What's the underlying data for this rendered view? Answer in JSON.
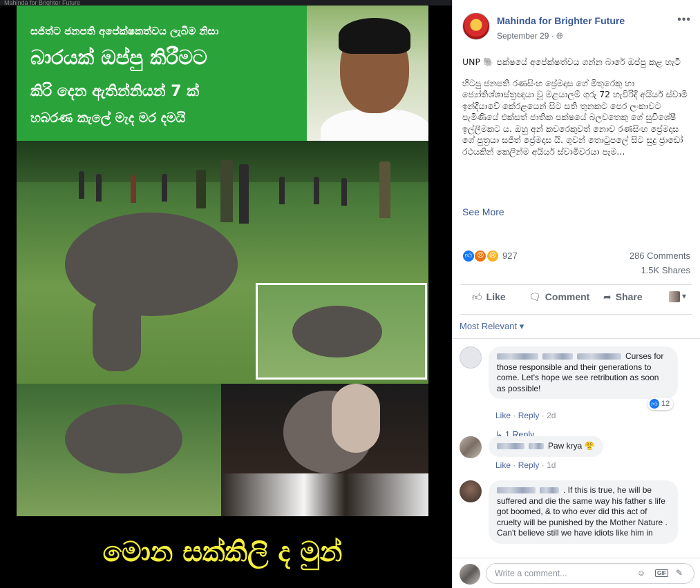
{
  "window": {
    "top_strip_text": "Mahinda for Brighter Future"
  },
  "photo": {
    "banner_lines": [
      "සජිත්ට ජනපති අපේක්ෂකත්වය ලැබීම නිසා",
      "බාරයක් ඔප්පු කිරීමට",
      "කිරි දෙන ඇතින්නියන් 7 ක්",
      "හබරණ කැලේ මැද මර දමයි"
    ],
    "caption": "මොන සක්කිලි ද මුන්"
  },
  "post": {
    "page_name": "Mahinda for Brighter Future",
    "date": "September 29",
    "audience_icon": "globe-icon",
    "more_icon": "•••",
    "text_p1": "UNP 🐘 පක්ෂයේ අපේක්ෂත්වය ගන්න බාරේ ඔප්පු කළ හැටි",
    "text_p2": "හිටපු ජනපති රණසිංහ ප්‍රේමදාස ගේ මිතුරෙකු හා ජ්‍යෝතිශ්ශාස්ත්‍රඥයා වූ මළයාලම් ගුරු 72 හැවිරිදි අයියර් ස්වාමි ඉන්දියාවේ කේරළයෙන් සිට සති තුනකට පෙර ලංකාවට පැමිණියේ එක්සත් ජාතික පක්ෂයේ බලවතෙකු ගේ සුවිශේෂී ඉල්ලීමකට ය. ඔහු අන් කවරෙකුවත් නොව රණසිංහ ප්‍රේමදාස ගේ පුත්‍රයා සජිත් ප්‍රේමදාස යි. ගුවන් තොටුපලේ සිට සුදු ජ්‍රාඩෝ රථයකින් කෙලින්ම අයියර් ස්වාමිවරයා පැම...",
    "see_more": "See More",
    "reaction_count": "927",
    "comments_count": "286 Comments",
    "shares_count": "1.5K Shares",
    "actions": {
      "like": "Like",
      "comment": "Comment",
      "share": "Share"
    },
    "sort_label": "Most Relevant ▾"
  },
  "comments": [
    {
      "text": "Curses for those responsible and their generations to come. Let's hope we see retribution as soon as possible!",
      "like": "Like",
      "reply": "Reply",
      "time": "2d",
      "like_count": "12",
      "replies": "1 Reply"
    },
    {
      "text": "Paw krya 😤",
      "like": "Like",
      "reply": "Reply",
      "time": "1d"
    },
    {
      "text": ". If this is true, he will be suffered and die the same way his father s life got boomed, & to who ever did this act of cruelty will be punished by the Mother Nature .\nCan't believe still we have idiots like him in"
    }
  ],
  "composer": {
    "placeholder": "Write a comment...",
    "gif": "GIF"
  },
  "colors": {
    "facebook_blue": "#385898",
    "link_blue": "#4b67a1",
    "banner_green": "#2aa43a",
    "caption_yellow": "#f4ef3a"
  }
}
